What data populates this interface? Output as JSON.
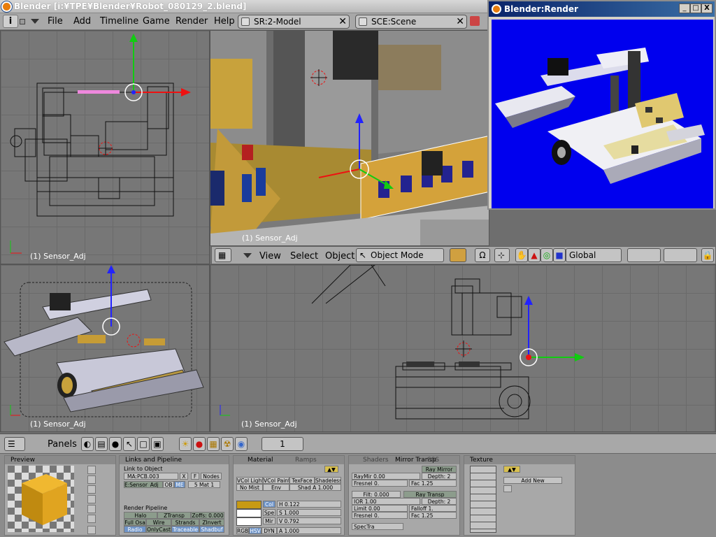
{
  "window": {
    "title": "Blender [i:¥TPE¥Blender¥Robot_080129_2.blend]"
  },
  "menubar": {
    "info_icon": "i",
    "items": [
      "File",
      "Add",
      "Timeline",
      "Game",
      "Render",
      "Help"
    ],
    "screen": "SR:2-Model",
    "scene": "SCE:Scene"
  },
  "viewports": {
    "top_left_label": "(1) Sensor_Adj",
    "top_mid_label": "(1) Sensor_Adj",
    "bottom_left_label": "(1) Sensor_Adj",
    "bottom_mid_label": "(1) Sensor_Adj"
  },
  "view3d_header": {
    "menus": [
      "View",
      "Select",
      "Object"
    ],
    "mode": "Object Mode",
    "orientation": "Global"
  },
  "render_window": {
    "title": "Blender:Render",
    "min": "_",
    "max": "□",
    "close": "X"
  },
  "buttons_window": {
    "panels_label": "Panels",
    "frame": "1",
    "preview": {
      "title": "Preview"
    },
    "links": {
      "title": "Links and Pipeline",
      "link_to_object": "Link to Object",
      "material_name": "MA:PCB.003",
      "x": "X",
      "f": "F",
      "nodes": "Nodes",
      "obj_name": "E:Sensor_Adj",
      "ob": "OB",
      "me": "ME",
      "mat_count": "5 Mat 1",
      "render_pipeline": "Render Pipeline",
      "pipeline_buttons": [
        "Halo",
        "ZTransp",
        "Zoffs: 0.000",
        "Full Osa",
        "Wire",
        "Strands",
        "ZInvert",
        "Radio",
        "OnlyCast",
        "Traceable",
        "Shadbuf"
      ]
    },
    "material": {
      "tabs": [
        "Material",
        "Ramps"
      ],
      "row1": [
        "VCol Light",
        "VCol Paint",
        "TexFace",
        "Shadeless"
      ],
      "row2": [
        "No Mist",
        "Env",
        "Shad A 1.000"
      ],
      "col": "Col",
      "spe": "Spe",
      "mir": "Mir",
      "h": "H 0.122",
      "s": "S 1.000",
      "v": "V 0.792",
      "rgb": [
        "RGB",
        "HSV",
        "DYN"
      ],
      "alpha": "A 1.000",
      "color": "#c79a14"
    },
    "shaders": {
      "tabs": [
        "Shaders",
        "Mirror Transp",
        "SSS"
      ],
      "ray_mirror": "Ray Mirror",
      "raymir": "RayMir 0.00",
      "depth1": "Depth: 2",
      "fresnel1": "Fresnel 0.",
      "fac1": "Fac 1.25",
      "filt": "Filt: 0.000",
      "ray_transp": "Ray Transp",
      "ior": "IOR 1.00",
      "depth2": "Depth: 2",
      "limit": "Limit 0.00",
      "falloff": "Falloff 1.",
      "fresnel2": "Fresnel 0.",
      "fac2": "Fac 1.25",
      "spectra": "SpecTra"
    },
    "texture": {
      "title": "Texture",
      "add_new": "Add New"
    }
  }
}
